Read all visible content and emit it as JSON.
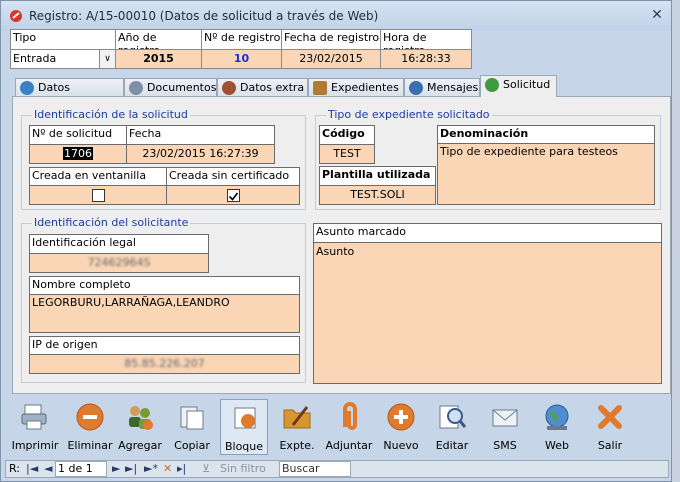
{
  "window": {
    "title": "Registro: A/15-00010 (Datos de solicitud a través de Web)",
    "close_symbol": "✕"
  },
  "header": {
    "tipo_label": "Tipo",
    "tipo_value": "Entrada",
    "anio_label": "Año de registro",
    "anio_value": "2015",
    "num_label": "Nº de registro",
    "num_value": "10",
    "fecha_label": "Fecha de registro",
    "fecha_value": "23/02/2015",
    "hora_label": "Hora de registro",
    "hora_value": "16:28:33"
  },
  "tabs": [
    {
      "label": "Datos generales",
      "icon": "globe-icon",
      "color": "#3b7fc4"
    },
    {
      "label": "Documentos",
      "icon": "document-icon",
      "color": "#7e8fa6"
    },
    {
      "label": "Datos extra",
      "icon": "info-icon",
      "color": "#a05030"
    },
    {
      "label": "Expedientes",
      "icon": "folder-icon",
      "color": "#b07a30"
    },
    {
      "label": "Mensajes",
      "icon": "message-icon",
      "color": "#3b70b0"
    },
    {
      "label": "Solicitud",
      "icon": "person-icon",
      "color": "#3e9a3e"
    }
  ],
  "solicitud": {
    "section_title": "Identificación de la solicitud",
    "num_label": "Nº de solicitud",
    "num_value": "1706",
    "fecha_label": "Fecha",
    "fecha_value": "23/02/2015 16:27:39",
    "ventanilla_label": "Creada en ventanilla",
    "ventanilla_checked": false,
    "sincert_label": "Creada sin certificado",
    "sincert_checked": true
  },
  "expediente": {
    "section_title": "Tipo de expediente solicitado",
    "codigo_label": "Código",
    "codigo_value": "TEST",
    "denominacion_label": "Denominación",
    "denominacion_value": "Tipo de expediente para testeos",
    "plantilla_label": "Plantilla utilizada",
    "plantilla_value": "TEST.SOLI"
  },
  "solicitante": {
    "section_title": "Identificación del solicitante",
    "idlegal_label": "Identificación legal",
    "idlegal_value": "72462964S",
    "nombre_label": "Nombre completo",
    "nombre_value": "LEGORBURU,LARRAÑAGA,LEANDRO",
    "ip_label": "IP de origen",
    "ip_value": "85.85.226.207"
  },
  "asunto": {
    "marcado_label": "Asunto marcado",
    "value": "Asunto"
  },
  "toolbar": [
    {
      "label": "Imprimir",
      "name": "imprimir-button",
      "icon": "printer-icon",
      "color": "#9fb1c4"
    },
    {
      "label": "Eliminar",
      "name": "eliminar-button",
      "icon": "minus-circle-icon",
      "color": "#e07a2c"
    },
    {
      "label": "Agregar",
      "name": "agregar-button",
      "icon": "add-people-icon",
      "color": "#7a9a3a"
    },
    {
      "label": "Copiar",
      "name": "copiar-button",
      "icon": "copy-icon",
      "color": "#c5d2e0"
    },
    {
      "label": "Bloque",
      "name": "bloque-button",
      "icon": "block-icon",
      "color": "#cfd9e6"
    },
    {
      "label": "Expte.",
      "name": "expte-button",
      "icon": "folder-pen-icon",
      "color": "#d7962e"
    },
    {
      "label": "Adjuntar",
      "name": "adjuntar-button",
      "icon": "paperclip-icon",
      "color": "#e07a2c"
    },
    {
      "label": "Nuevo",
      "name": "nuevo-button",
      "icon": "plus-circle-icon",
      "color": "#e07a2c"
    },
    {
      "label": "Editar",
      "name": "editar-button",
      "icon": "magnifier-icon",
      "color": "#7e9ac0"
    },
    {
      "label": "SMS",
      "name": "sms-button",
      "icon": "envelope-icon",
      "color": "#b7c7da"
    },
    {
      "label": "Web",
      "name": "web-button",
      "icon": "globe-icon",
      "color": "#4f8fd0"
    },
    {
      "label": "Salir",
      "name": "salir-button",
      "icon": "exit-x-icon",
      "color": "#e07a2c"
    }
  ],
  "statusbar": {
    "record_label": "R:",
    "record_value": "1 de 1",
    "filter_label": "Sin filtro",
    "search_label": "Buscar"
  }
}
